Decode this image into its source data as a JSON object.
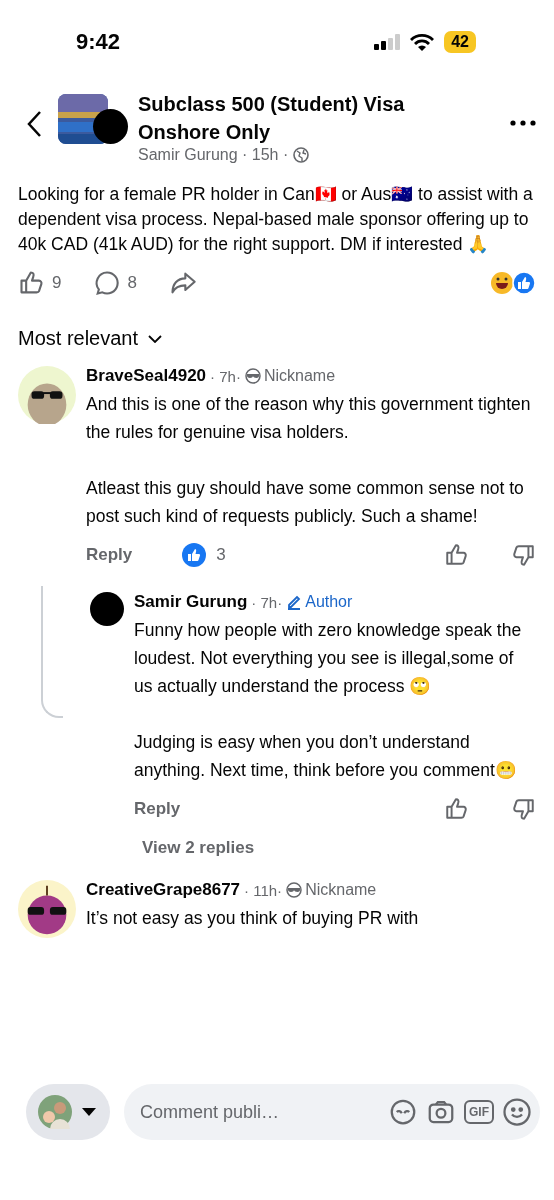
{
  "status_bar": {
    "time": "9:42",
    "battery": "42"
  },
  "post": {
    "group_name": "Subclass 500 (Student) Visa Onshore Only",
    "author": "Samir Gurung",
    "time": "· 15h ·",
    "body": "Looking for a female PR holder in Can🇨🇦 or Aus🇦🇺 to assist with a dependent visa process. Nepal-based male sponsor offering up to 40k CAD (41k AUD) for the right support. DM if interested 🙏",
    "likes": "9",
    "comments": "8"
  },
  "sort": {
    "label": "Most relevant"
  },
  "comments": [
    {
      "avatar": {
        "kind": "seal"
      },
      "author": "BraveSeal4920",
      "time": "· 7h·",
      "badge": {
        "kind": "nickname",
        "label": "Nickname"
      },
      "paragraphs": [
        "And this is one of the reason why this government tighten the rules for genuine visa holders.",
        "Atleast this guy should have some common sense not to post such kind of requests publicly. Such a shame!"
      ],
      "reply": "Reply",
      "reactions": "3",
      "children": [
        {
          "avatar": {
            "kind": "blank"
          },
          "author": "Samir Gurung",
          "time": "· 7h·",
          "badge": {
            "kind": "author",
            "label": "Author"
          },
          "paragraphs": [
            "Funny how people with zero knowledge speak the loudest. Not everything you see is illegal,some of us actually understand the process 🙄",
            "Judging is easy when you don’t understand anything. Next time, think before you comment😬"
          ],
          "reply": "Reply"
        }
      ],
      "view_replies": "View 2 replies"
    },
    {
      "avatar": {
        "kind": "grape"
      },
      "author": "CreativeGrape8677",
      "time": "· 11h·",
      "badge": {
        "kind": "nickname",
        "label": "Nickname"
      },
      "paragraphs": [
        "It’s not easy as you think of buying PR with"
      ]
    }
  ],
  "composer": {
    "placeholder": "Comment publi…",
    "gif": "GIF"
  }
}
